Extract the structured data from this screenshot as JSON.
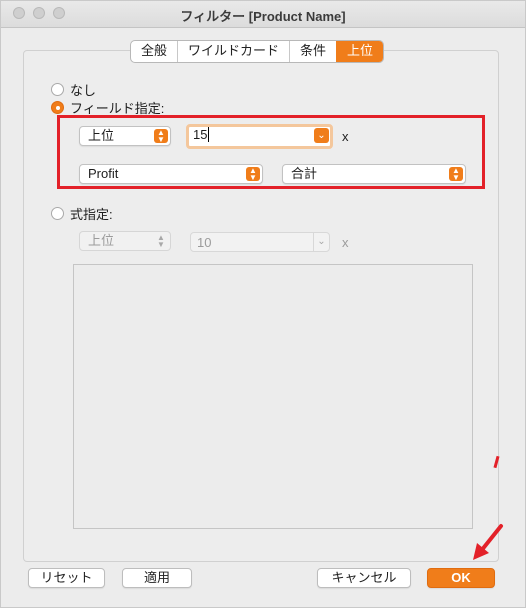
{
  "window": {
    "title": "フィルター [Product Name]"
  },
  "tabs": [
    {
      "label": "全般",
      "active": false
    },
    {
      "label": "ワイルドカード",
      "active": false
    },
    {
      "label": "条件",
      "active": false
    },
    {
      "label": "上位",
      "active": true
    }
  ],
  "options": {
    "none_label": "なし",
    "by_field_label": "フィールド指定:",
    "by_formula_label": "式指定:",
    "selected": "by_field"
  },
  "by_field": {
    "direction": "上位",
    "count": "15",
    "x_label": "x",
    "field": "Profit",
    "aggregation": "合計"
  },
  "by_formula": {
    "direction": "上位",
    "count": "10",
    "x_label": "x"
  },
  "buttons": {
    "reset": "リセット",
    "apply": "適用",
    "cancel": "キャンセル",
    "ok": "OK"
  },
  "colors": {
    "accent": "#f07d1a",
    "annotation": "#e32129"
  }
}
